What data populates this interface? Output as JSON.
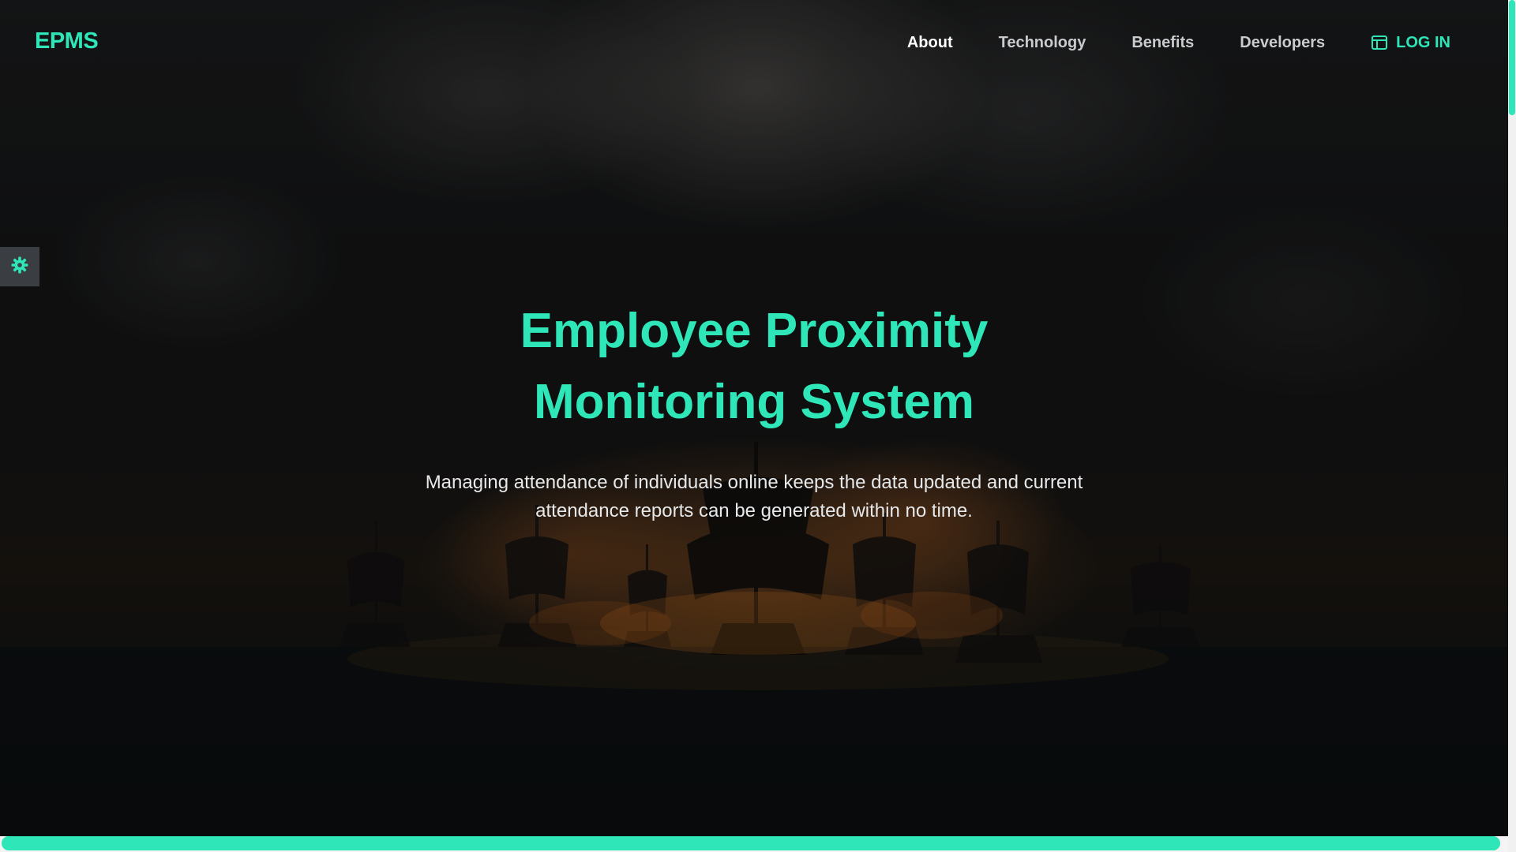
{
  "brand": {
    "name": "EPMS"
  },
  "nav": {
    "links": [
      {
        "label": "About",
        "active": true
      },
      {
        "label": "Technology",
        "active": false
      },
      {
        "label": "Benefits",
        "active": false
      },
      {
        "label": "Developers",
        "active": false
      }
    ],
    "login_label": "LOG IN",
    "login_icon": "layout-icon"
  },
  "settings": {
    "icon": "gear-icon"
  },
  "hero": {
    "title_line1": "Employee Proximity",
    "title_line2": "Monitoring System",
    "subtitle_line1": "Managing attendance of individuals online keeps the data updated and current",
    "subtitle_line2": "attendance reports can be generated within no time."
  },
  "colors": {
    "accent": "#2ee6b8",
    "nav_text": "#c9cbcd",
    "nav_active": "#ffffff",
    "settings_bg": "#3a3e42"
  }
}
